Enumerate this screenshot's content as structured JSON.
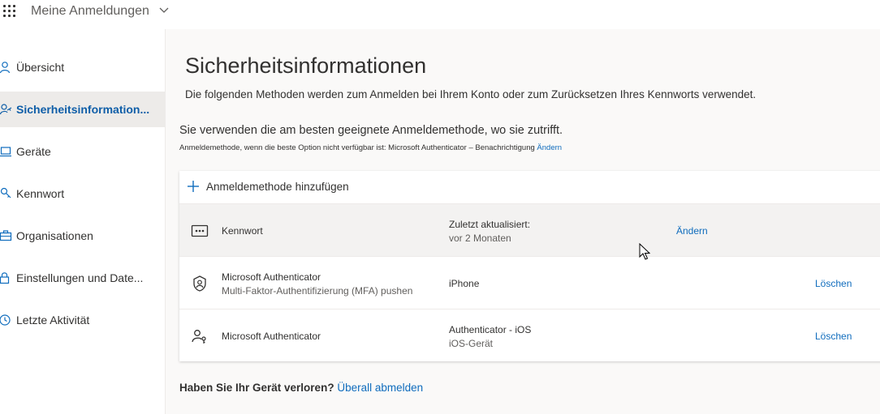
{
  "header": {
    "app_title": "Meine Anmeldungen"
  },
  "sidebar": {
    "items": [
      {
        "label": "Übersicht",
        "icon": "person-icon"
      },
      {
        "label": "Sicherheitsinformation...",
        "icon": "security-info-icon",
        "active": true
      },
      {
        "label": "Geräte",
        "icon": "laptop-icon"
      },
      {
        "label": "Kennwort",
        "icon": "key-icon"
      },
      {
        "label": "Organisationen",
        "icon": "briefcase-icon"
      },
      {
        "label": "Einstellungen und Date...",
        "icon": "lock-icon"
      },
      {
        "label": "Letzte Aktivität",
        "icon": "clock-icon"
      }
    ]
  },
  "main": {
    "title": "Sicherheitsinformationen",
    "subtitle": "Die folgenden Methoden werden zum Anmelden bei Ihrem Konto oder zum Zurücksetzen Ihres Kennworts verwendet.",
    "default_method_line": "Sie verwenden die am besten geeignete Anmeldemethode, wo sie zutrifft.",
    "default_method_small": "Anmeldemethode, wenn die beste Option nicht verfügbar ist: Microsoft Authenticator – Benachrichtigung",
    "default_method_change": "Ändern",
    "add_method": "Anmeldemethode hinzufügen",
    "methods": [
      {
        "icon": "password-dots-icon",
        "name": "Kennwort",
        "detail1": "Zuletzt aktualisiert:",
        "detail2": "vor 2 Monaten",
        "action": "Ändern"
      },
      {
        "icon": "authenticator-icon",
        "name": "Microsoft Authenticator",
        "name_sub": "Multi-Faktor-Authentifizierung (MFA) pushen",
        "detail1": "iPhone",
        "action": "Löschen"
      },
      {
        "icon": "passwordless-icon",
        "name": "Microsoft Authenticator",
        "detail1": "Authenticator - iOS",
        "detail2": "iOS-Gerät",
        "action": "Löschen"
      }
    ],
    "lost_device_question": "Haben Sie Ihr Gerät verloren?",
    "lost_device_link": "Überall abmelden"
  },
  "colors": {
    "accent": "#0f6cbd",
    "active_nav_bg": "#edebe9",
    "page_bg": "#faf9f8"
  }
}
